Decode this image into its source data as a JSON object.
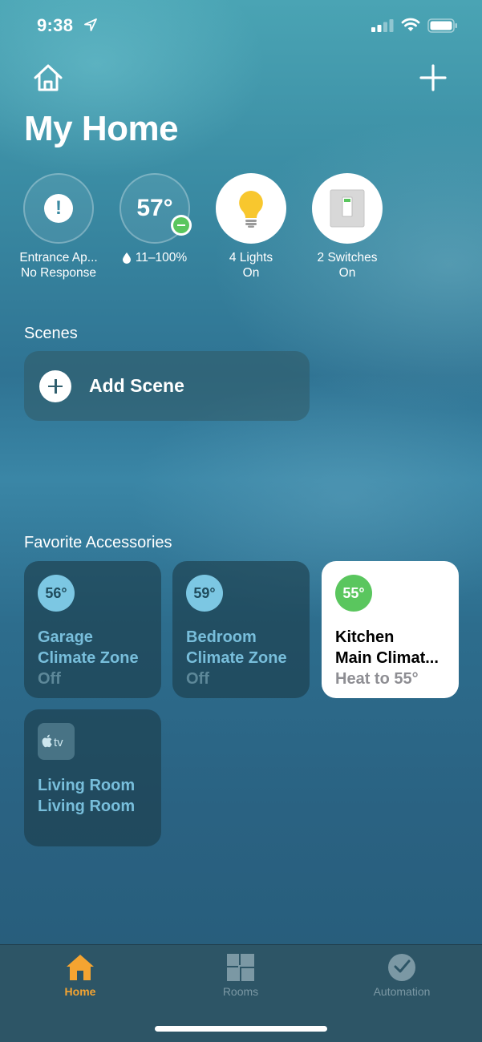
{
  "status_bar": {
    "time": "9:38"
  },
  "header": {
    "title": "My Home"
  },
  "status_items": [
    {
      "value": "",
      "line1": "Entrance Ap...",
      "line2": "No Response",
      "icon": "alert-icon"
    },
    {
      "value": "57°",
      "line1": "11–100%",
      "line2": "",
      "icon": "thermostat-icon"
    },
    {
      "value": "",
      "line1": "4 Lights",
      "line2": "On",
      "icon": "lightbulb-icon"
    },
    {
      "value": "",
      "line1": "2 Switches",
      "line2": "On",
      "icon": "switch-icon"
    }
  ],
  "scenes": {
    "title": "Scenes",
    "add_label": "Add Scene"
  },
  "favorites": {
    "title": "Favorite Accessories",
    "tiles": [
      {
        "badge": "56°",
        "line1": "Garage",
        "line2": "Climate Zone",
        "line3": "Off"
      },
      {
        "badge": "59°",
        "line1": "Bedroom",
        "line2": "Climate Zone",
        "line3": "Off"
      },
      {
        "badge": "55°",
        "line1": "Kitchen",
        "line2": "Main Climat...",
        "line3": "Heat to 55°"
      },
      {
        "badge": "tv",
        "line1": "Living Room",
        "line2": "Living Room",
        "line3": ""
      }
    ]
  },
  "tabbar": {
    "tabs": [
      {
        "label": "Home",
        "active": true
      },
      {
        "label": "Rooms",
        "active": false
      },
      {
        "label": "Automation",
        "active": false
      }
    ]
  },
  "colors": {
    "accent": "#f5a431",
    "green": "#5ac65e",
    "light_blue": "#7cc7e3",
    "bulb": "#f8c72e"
  }
}
